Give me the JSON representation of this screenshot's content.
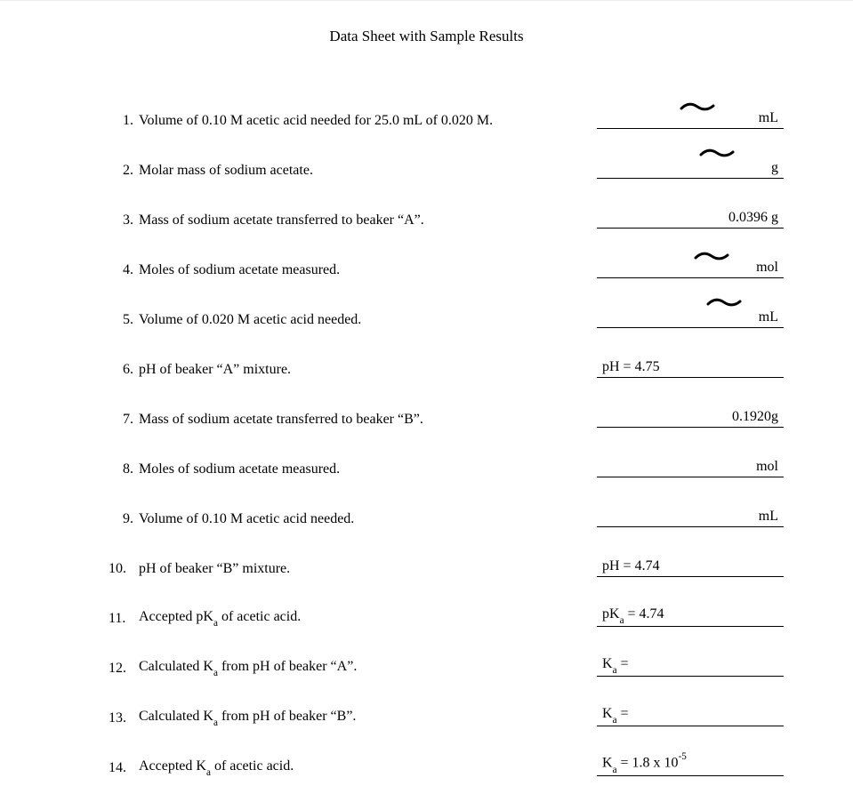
{
  "title": "Data Sheet with Sample Results",
  "rows": [
    {
      "num": "1.",
      "label_html": "Volume of 0.10 M acetic acid needed for 25.0 mL of 0.020 M.",
      "value": "",
      "unit": "mL",
      "squiggle": true,
      "sq_dx": -12,
      "sq_dy": -6
    },
    {
      "num": "2.",
      "label_html": "Molar mass of sodium acetate.",
      "value": "",
      "unit": "g",
      "squiggle": true,
      "sq_dx": 10,
      "sq_dy": -10
    },
    {
      "num": "3.",
      "label_html": "Mass of sodium acetate transferred to beaker “A”.",
      "value": "",
      "unit": "0.0396 g",
      "squiggle": false
    },
    {
      "num": "4.",
      "label_html": "Moles of sodium acetate measured.",
      "value": "",
      "unit": "mol",
      "squiggle": true,
      "sq_dx": 4,
      "sq_dy": -6
    },
    {
      "num": "5.",
      "label_html": "Volume of 0.020 M acetic acid needed.",
      "value": "",
      "unit": "mL",
      "squiggle": true,
      "sq_dx": 18,
      "sq_dy": -10
    },
    {
      "num": "6.",
      "label_html": "pH of beaker “A” mixture.",
      "value": "pH = 4.75",
      "unit": "",
      "squiggle": false
    },
    {
      "num": "7.",
      "label_html": "Mass of sodium acetate transferred to beaker “B”.",
      "value": "",
      "unit": "0.1920g",
      "squiggle": false
    },
    {
      "num": "8.",
      "label_html": "Moles of sodium acetate measured.",
      "value": "",
      "unit": "mol",
      "squiggle": false
    },
    {
      "num": "9.",
      "label_html": "Volume of 0.10 M acetic acid needed.",
      "value": "",
      "unit": "mL",
      "squiggle": false
    },
    {
      "num": "10.",
      "label_html": "pH of beaker “B” mixture.",
      "value": "pH = 4.74",
      "unit": "",
      "squiggle": false
    },
    {
      "num": "11.",
      "label_html": "Accepted pK<span class=\"sub\">a</span> of acetic acid.",
      "value": "pK<span class=\"sub\">a</span> = 4.74",
      "unit": "",
      "squiggle": false
    },
    {
      "num": "12.",
      "label_html": "Calculated K<span class=\"sub\">a</span> from pH of beaker “A”.",
      "value": "K<span class=\"sub\">a</span> =",
      "unit": "",
      "squiggle": false
    },
    {
      "num": "13.",
      "label_html": "Calculated K<span class=\"sub\">a</span> from pH of beaker “B”.",
      "value": "K<span class=\"sub\">a</span> =",
      "unit": "",
      "squiggle": false
    },
    {
      "num": "14.",
      "label_html": "Accepted K<span class=\"sub\">a</span> of acetic acid.",
      "value": "K<span class=\"sub\">a</span> = 1.8 x 10<span class=\"sup\">-5</span>",
      "unit": "",
      "squiggle": false
    }
  ]
}
